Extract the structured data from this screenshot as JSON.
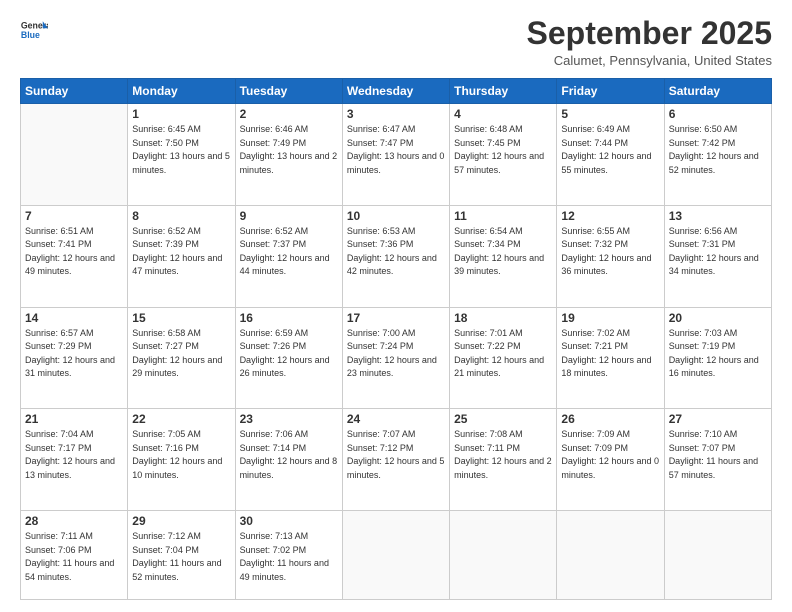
{
  "header": {
    "logo_general": "General",
    "logo_blue": "Blue",
    "month_title": "September 2025",
    "subtitle": "Calumet, Pennsylvania, United States"
  },
  "weekdays": [
    "Sunday",
    "Monday",
    "Tuesday",
    "Wednesday",
    "Thursday",
    "Friday",
    "Saturday"
  ],
  "weeks": [
    [
      {
        "num": "",
        "sunrise": "",
        "sunset": "",
        "daylight": ""
      },
      {
        "num": "1",
        "sunrise": "Sunrise: 6:45 AM",
        "sunset": "Sunset: 7:50 PM",
        "daylight": "Daylight: 13 hours and 5 minutes."
      },
      {
        "num": "2",
        "sunrise": "Sunrise: 6:46 AM",
        "sunset": "Sunset: 7:49 PM",
        "daylight": "Daylight: 13 hours and 2 minutes."
      },
      {
        "num": "3",
        "sunrise": "Sunrise: 6:47 AM",
        "sunset": "Sunset: 7:47 PM",
        "daylight": "Daylight: 13 hours and 0 minutes."
      },
      {
        "num": "4",
        "sunrise": "Sunrise: 6:48 AM",
        "sunset": "Sunset: 7:45 PM",
        "daylight": "Daylight: 12 hours and 57 minutes."
      },
      {
        "num": "5",
        "sunrise": "Sunrise: 6:49 AM",
        "sunset": "Sunset: 7:44 PM",
        "daylight": "Daylight: 12 hours and 55 minutes."
      },
      {
        "num": "6",
        "sunrise": "Sunrise: 6:50 AM",
        "sunset": "Sunset: 7:42 PM",
        "daylight": "Daylight: 12 hours and 52 minutes."
      }
    ],
    [
      {
        "num": "7",
        "sunrise": "Sunrise: 6:51 AM",
        "sunset": "Sunset: 7:41 PM",
        "daylight": "Daylight: 12 hours and 49 minutes."
      },
      {
        "num": "8",
        "sunrise": "Sunrise: 6:52 AM",
        "sunset": "Sunset: 7:39 PM",
        "daylight": "Daylight: 12 hours and 47 minutes."
      },
      {
        "num": "9",
        "sunrise": "Sunrise: 6:52 AM",
        "sunset": "Sunset: 7:37 PM",
        "daylight": "Daylight: 12 hours and 44 minutes."
      },
      {
        "num": "10",
        "sunrise": "Sunrise: 6:53 AM",
        "sunset": "Sunset: 7:36 PM",
        "daylight": "Daylight: 12 hours and 42 minutes."
      },
      {
        "num": "11",
        "sunrise": "Sunrise: 6:54 AM",
        "sunset": "Sunset: 7:34 PM",
        "daylight": "Daylight: 12 hours and 39 minutes."
      },
      {
        "num": "12",
        "sunrise": "Sunrise: 6:55 AM",
        "sunset": "Sunset: 7:32 PM",
        "daylight": "Daylight: 12 hours and 36 minutes."
      },
      {
        "num": "13",
        "sunrise": "Sunrise: 6:56 AM",
        "sunset": "Sunset: 7:31 PM",
        "daylight": "Daylight: 12 hours and 34 minutes."
      }
    ],
    [
      {
        "num": "14",
        "sunrise": "Sunrise: 6:57 AM",
        "sunset": "Sunset: 7:29 PM",
        "daylight": "Daylight: 12 hours and 31 minutes."
      },
      {
        "num": "15",
        "sunrise": "Sunrise: 6:58 AM",
        "sunset": "Sunset: 7:27 PM",
        "daylight": "Daylight: 12 hours and 29 minutes."
      },
      {
        "num": "16",
        "sunrise": "Sunrise: 6:59 AM",
        "sunset": "Sunset: 7:26 PM",
        "daylight": "Daylight: 12 hours and 26 minutes."
      },
      {
        "num": "17",
        "sunrise": "Sunrise: 7:00 AM",
        "sunset": "Sunset: 7:24 PM",
        "daylight": "Daylight: 12 hours and 23 minutes."
      },
      {
        "num": "18",
        "sunrise": "Sunrise: 7:01 AM",
        "sunset": "Sunset: 7:22 PM",
        "daylight": "Daylight: 12 hours and 21 minutes."
      },
      {
        "num": "19",
        "sunrise": "Sunrise: 7:02 AM",
        "sunset": "Sunset: 7:21 PM",
        "daylight": "Daylight: 12 hours and 18 minutes."
      },
      {
        "num": "20",
        "sunrise": "Sunrise: 7:03 AM",
        "sunset": "Sunset: 7:19 PM",
        "daylight": "Daylight: 12 hours and 16 minutes."
      }
    ],
    [
      {
        "num": "21",
        "sunrise": "Sunrise: 7:04 AM",
        "sunset": "Sunset: 7:17 PM",
        "daylight": "Daylight: 12 hours and 13 minutes."
      },
      {
        "num": "22",
        "sunrise": "Sunrise: 7:05 AM",
        "sunset": "Sunset: 7:16 PM",
        "daylight": "Daylight: 12 hours and 10 minutes."
      },
      {
        "num": "23",
        "sunrise": "Sunrise: 7:06 AM",
        "sunset": "Sunset: 7:14 PM",
        "daylight": "Daylight: 12 hours and 8 minutes."
      },
      {
        "num": "24",
        "sunrise": "Sunrise: 7:07 AM",
        "sunset": "Sunset: 7:12 PM",
        "daylight": "Daylight: 12 hours and 5 minutes."
      },
      {
        "num": "25",
        "sunrise": "Sunrise: 7:08 AM",
        "sunset": "Sunset: 7:11 PM",
        "daylight": "Daylight: 12 hours and 2 minutes."
      },
      {
        "num": "26",
        "sunrise": "Sunrise: 7:09 AM",
        "sunset": "Sunset: 7:09 PM",
        "daylight": "Daylight: 12 hours and 0 minutes."
      },
      {
        "num": "27",
        "sunrise": "Sunrise: 7:10 AM",
        "sunset": "Sunset: 7:07 PM",
        "daylight": "Daylight: 11 hours and 57 minutes."
      }
    ],
    [
      {
        "num": "28",
        "sunrise": "Sunrise: 7:11 AM",
        "sunset": "Sunset: 7:06 PM",
        "daylight": "Daylight: 11 hours and 54 minutes."
      },
      {
        "num": "29",
        "sunrise": "Sunrise: 7:12 AM",
        "sunset": "Sunset: 7:04 PM",
        "daylight": "Daylight: 11 hours and 52 minutes."
      },
      {
        "num": "30",
        "sunrise": "Sunrise: 7:13 AM",
        "sunset": "Sunset: 7:02 PM",
        "daylight": "Daylight: 11 hours and 49 minutes."
      },
      {
        "num": "",
        "sunrise": "",
        "sunset": "",
        "daylight": ""
      },
      {
        "num": "",
        "sunrise": "",
        "sunset": "",
        "daylight": ""
      },
      {
        "num": "",
        "sunrise": "",
        "sunset": "",
        "daylight": ""
      },
      {
        "num": "",
        "sunrise": "",
        "sunset": "",
        "daylight": ""
      }
    ]
  ]
}
